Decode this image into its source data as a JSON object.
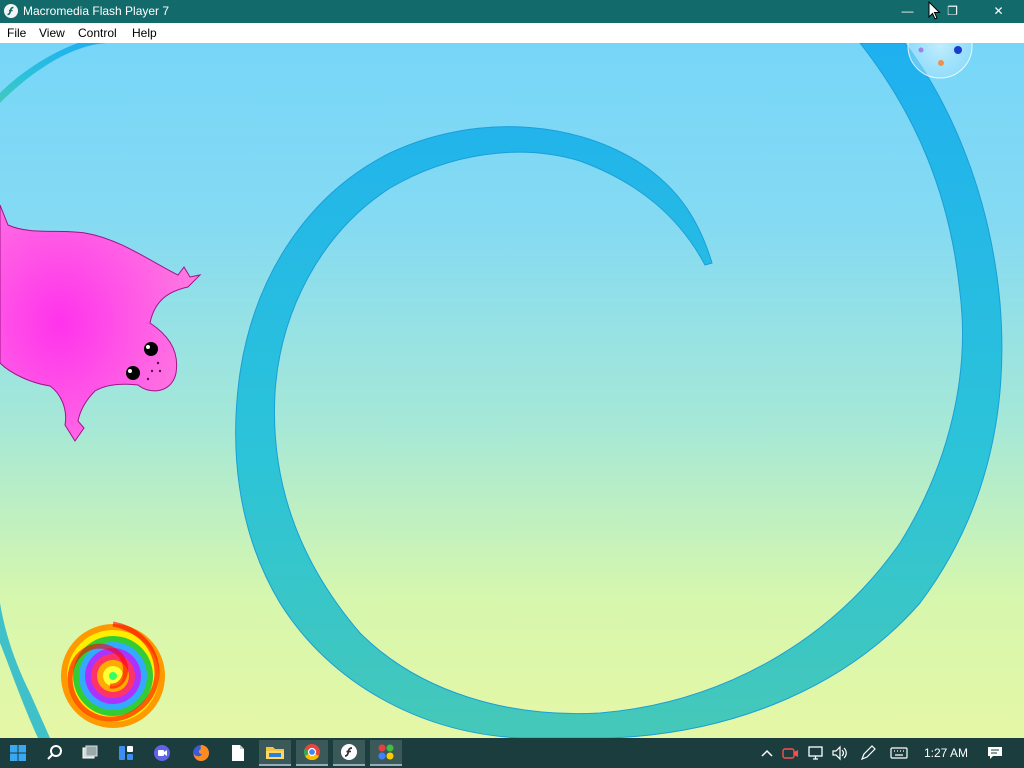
{
  "window": {
    "title": "Macromedia Flash Player 7",
    "controls": {
      "minimize": "—",
      "maximize": "❐",
      "close": "✕"
    }
  },
  "menu": {
    "items": [
      "File",
      "View",
      "Control",
      "Help"
    ]
  },
  "stage": {
    "objects": [
      "blue-spiral",
      "pink-creature",
      "rainbow-swirl",
      "corner-bubble"
    ],
    "colors": {
      "spiral": "#2fb6ee",
      "creature": "#ff33e6",
      "bg_top": "#77d6f8",
      "bg_bottom": "#e5f7a6"
    }
  },
  "taskbar": {
    "apps": [
      {
        "icon": "windows-start-icon"
      },
      {
        "icon": "search-icon"
      },
      {
        "icon": "task-view-icon"
      },
      {
        "icon": "widgets-icon"
      },
      {
        "icon": "teams-chat-icon"
      },
      {
        "icon": "firefox-icon"
      },
      {
        "icon": "document-icon"
      },
      {
        "icon": "file-explorer-icon"
      },
      {
        "icon": "chrome-icon"
      },
      {
        "icon": "flash-player-icon"
      },
      {
        "icon": "colorful-app-icon"
      }
    ],
    "tray": [
      "chevron-up-icon",
      "camera-icon",
      "network-icon",
      "volume-icon",
      "pen-icon",
      "keyboard-icon"
    ],
    "clock": "1:27 AM",
    "notification": "notification-icon"
  }
}
